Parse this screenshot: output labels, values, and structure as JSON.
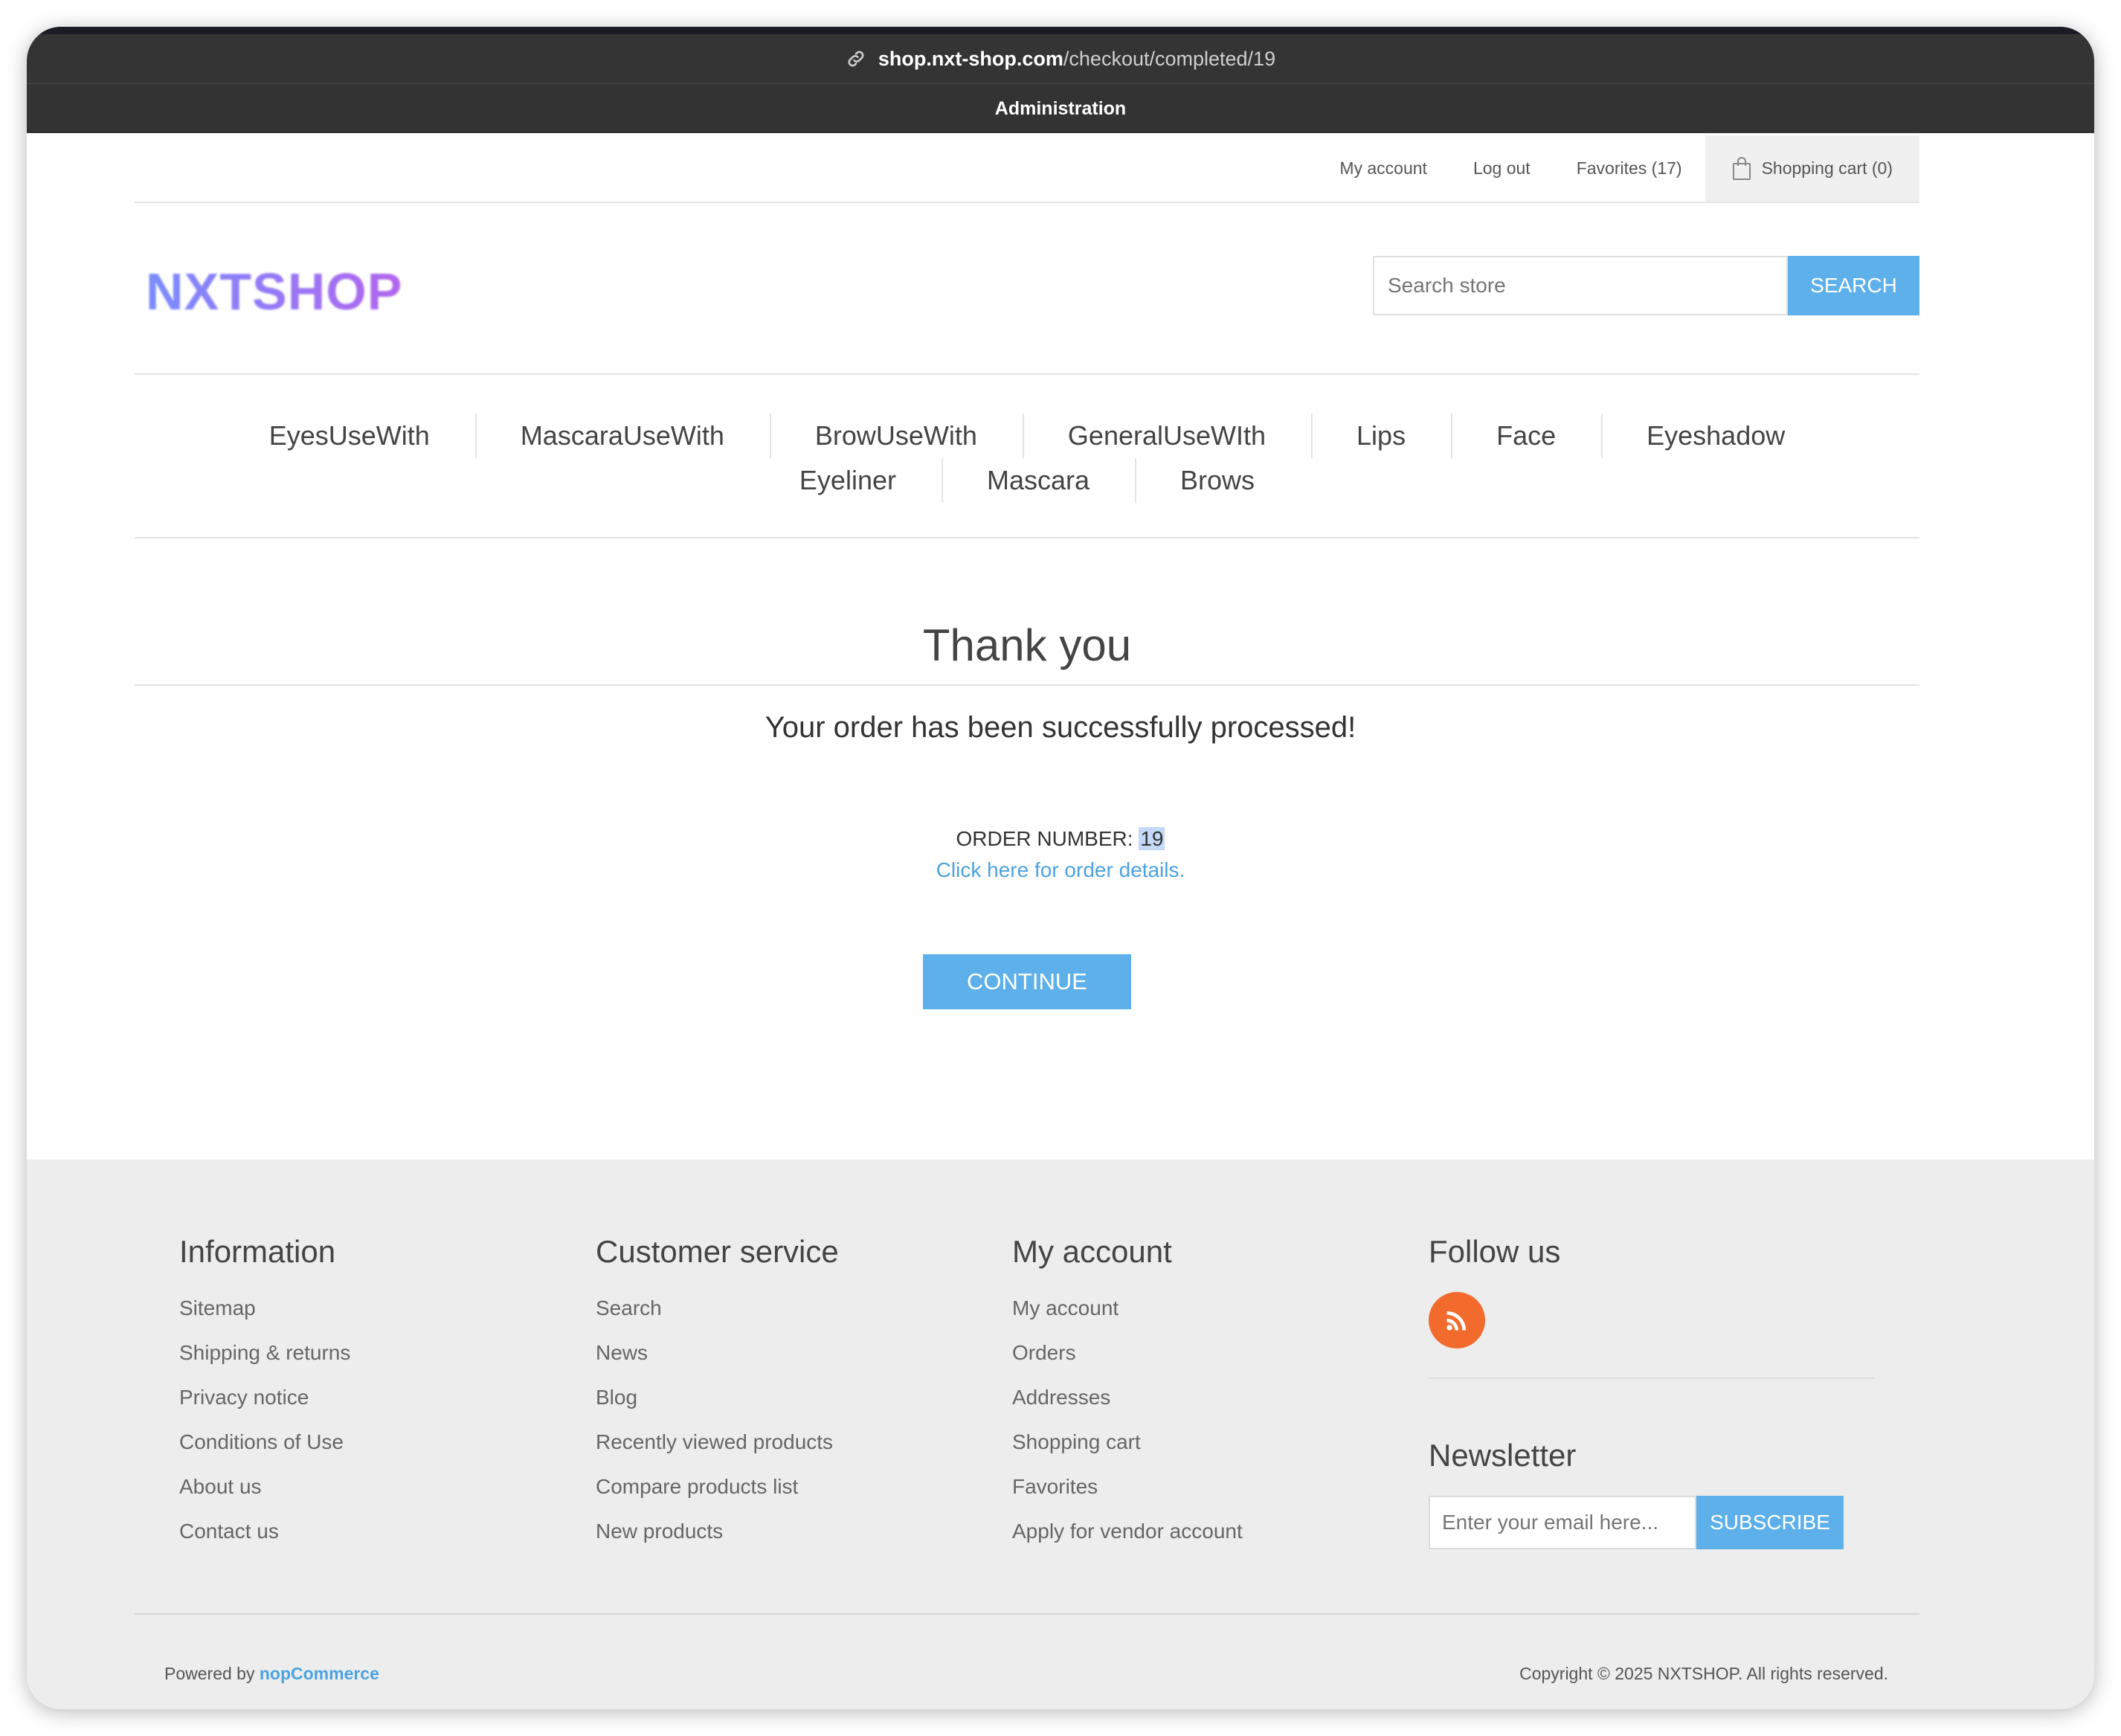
{
  "browser": {
    "url_host": "shop.nxt-shop.com",
    "url_path": "/checkout/completed/19",
    "admin_label": "Administration"
  },
  "header": {
    "my_account": "My account",
    "log_out": "Log out",
    "favorites": "Favorites (17)",
    "shopping_cart": "Shopping cart (0)",
    "logo": "NXTSHOP"
  },
  "search": {
    "placeholder": "Search store",
    "button": "SEARCH"
  },
  "nav": {
    "row1": [
      "EyesUseWith",
      "MascaraUseWith",
      "BrowUseWith",
      "GeneralUseWIth",
      "Lips",
      "Face",
      "Eyeshadow"
    ],
    "row2": [
      "Eyeliner",
      "Mascara",
      "Brows"
    ]
  },
  "main": {
    "title": "Thank you",
    "success_message": "Your order has been successfully processed!",
    "order_number_label": "ORDER NUMBER:",
    "order_number": "19",
    "details_link": "Click here for order details.",
    "continue_button": "CONTINUE"
  },
  "footer": {
    "information": {
      "title": "Information",
      "items": [
        "Sitemap",
        "Shipping & returns",
        "Privacy notice",
        "Conditions of Use",
        "About us",
        "Contact us"
      ]
    },
    "customer_service": {
      "title": "Customer service",
      "items": [
        "Search",
        "News",
        "Blog",
        "Recently viewed products",
        "Compare products list",
        "New products"
      ]
    },
    "my_account": {
      "title": "My account",
      "items": [
        "My account",
        "Orders",
        "Addresses",
        "Shopping cart",
        "Favorites",
        "Apply for vendor account"
      ]
    },
    "follow_us": {
      "title": "Follow us",
      "icon": "rss-icon"
    },
    "newsletter": {
      "title": "Newsletter",
      "placeholder": "Enter your email here...",
      "button": "SUBSCRIBE"
    },
    "powered_by": "Powered by",
    "powered_link": "nopCommerce",
    "copyright": "Copyright © 2025 NXTSHOP. All rights reserved."
  },
  "colors": {
    "accent": "#5eb0ea",
    "link": "#4ba3e0",
    "rss": "#f26b2d",
    "footer_bg": "#ededed"
  }
}
